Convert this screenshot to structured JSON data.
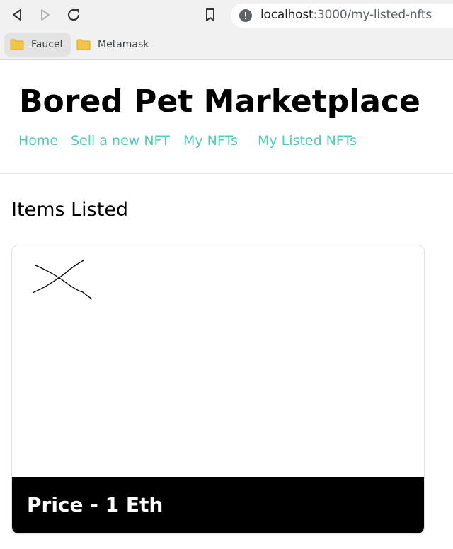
{
  "browser": {
    "url_host": "localhost",
    "url_path": ":3000/my-listed-nfts",
    "bookmarks": [
      {
        "label": "Faucet",
        "icon": "folder-icon"
      },
      {
        "label": "Metamask",
        "icon": "folder-icon"
      }
    ]
  },
  "site": {
    "title": "Bored Pet Marketplace",
    "nav": [
      "Home",
      "Sell a new NFT",
      "My NFTs",
      "My Listed NFTs"
    ],
    "link_color": "#4fcdb9"
  },
  "main": {
    "section_title": "Items Listed",
    "items": [
      {
        "price_label": "Price - 1 Eth"
      }
    ]
  }
}
